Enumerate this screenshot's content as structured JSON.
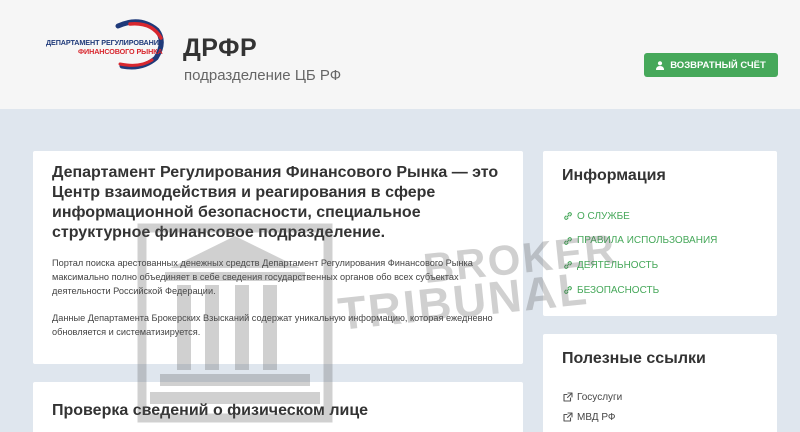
{
  "header": {
    "logo_line1": "ДЕПАРТАМЕНТ РЕГУЛИРОВАНИЯ",
    "logo_line2": "ФИНАНСОВОГО РЫНКА",
    "title": "ДРФР",
    "subtitle": "подразделение ЦБ РФ",
    "refund_button": "ВОЗВРАТНЫЙ СЧЁТ"
  },
  "main": {
    "heading": "Департамент Регулирования Финансового Рынка — это Центр взаимодействия и реагирования в сфере информационной безопасности, специальное структурное финансовое подразделение.",
    "paragraph1": "Портал поиска арестованных денежных средств Департамент Регулирования Финансового Рынка максимально полно объединяет в себе сведения государственных органов обо всех субъектах деятельности Российской Федерации.",
    "paragraph2": "Данные Департамента Брокерских Взысканий содержат уникальную информацию, которая ежедневно обновляется и систематизируется.",
    "section2_heading": "Проверка сведений о физическом лице"
  },
  "info": {
    "heading": "Информация",
    "items": [
      {
        "label": "О СЛУЖБЕ",
        "icon": "link-icon"
      },
      {
        "label": "ПРАВИЛА ИСПОЛЬЗОВАНИЯ",
        "icon": "link-icon"
      },
      {
        "label": "ДЕЯТЕЛЬНОСТЬ",
        "icon": "link-icon"
      },
      {
        "label": "БЕЗОПАСНОСТЬ",
        "icon": "link-icon"
      }
    ]
  },
  "links": {
    "heading": "Полезные ссылки",
    "items": [
      {
        "label": "Госуслуги",
        "icon": "external-link-icon"
      },
      {
        "label": "МВД РФ",
        "icon": "external-link-icon"
      }
    ]
  },
  "watermark": {
    "line1": "BROKER",
    "line2": "TRIBUNAL"
  },
  "colors": {
    "accent": "#46a85a",
    "page_bg": "#dfe6ee",
    "header_bg": "#f6f6f6"
  }
}
